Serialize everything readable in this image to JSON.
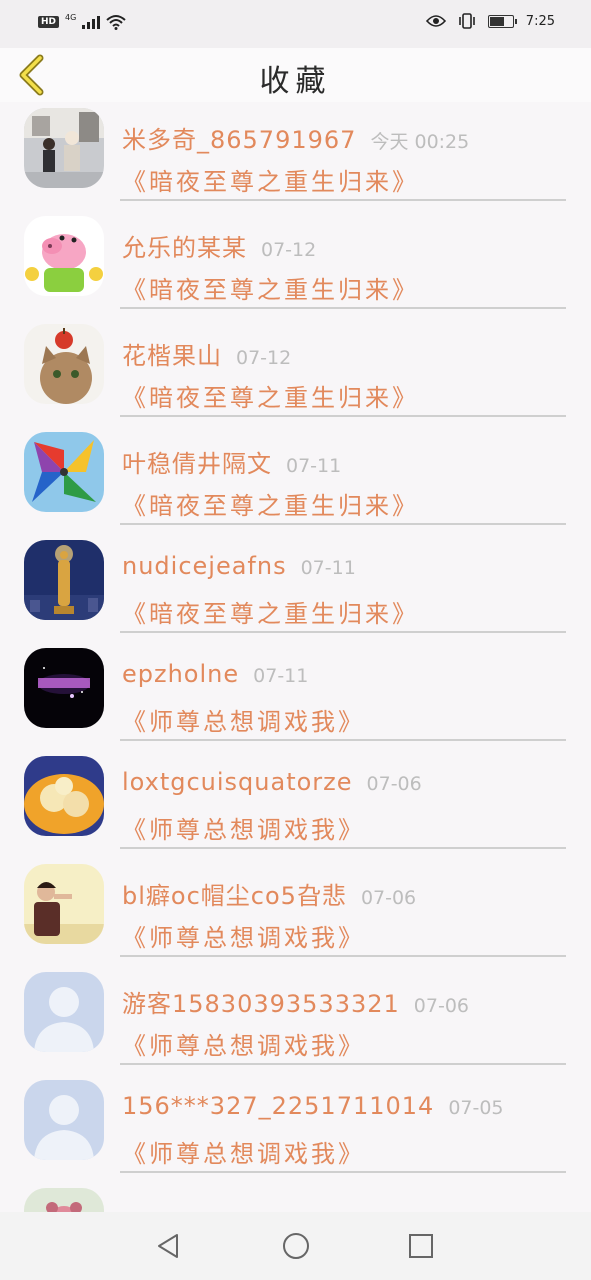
{
  "status_bar": {
    "hd": "HD",
    "network": "4G",
    "time": "7:25",
    "battery_level": 0.6
  },
  "header": {
    "title": "收藏",
    "back_icon": "chevron-left-icon"
  },
  "items": [
    {
      "name": "米多奇_865791967",
      "date": "今天 00:25",
      "book": "《暗夜至尊之重生归来》",
      "avatar": "photo-people"
    },
    {
      "name": "允乐的某某",
      "date": "07-12",
      "book": "《暗夜至尊之重生归来》",
      "avatar": "peppa-pig"
    },
    {
      "name": "花楷果山",
      "date": "07-12",
      "book": "《暗夜至尊之重生归来》",
      "avatar": "cat-with-apple"
    },
    {
      "name": "叶稳倩井隔文",
      "date": "07-11",
      "book": "《暗夜至尊之重生归来》",
      "avatar": "pinwheel"
    },
    {
      "name": "nudicejeafns",
      "date": "07-11",
      "book": "《暗夜至尊之重生归来》",
      "avatar": "buddha-statue"
    },
    {
      "name": "epzholne",
      "date": "07-11",
      "book": "《师尊总想调戏我》",
      "avatar": "constellation-dark"
    },
    {
      "name": "loxtgcuisquatorze",
      "date": "07-06",
      "book": "《师尊总想调戏我》",
      "avatar": "food-bowl"
    },
    {
      "name": "bl癖oc帽尘co5旮悲",
      "date": "07-06",
      "book": "《师尊总想调戏我》",
      "avatar": "photo-person"
    },
    {
      "name": "游客15830393533321",
      "date": "07-06",
      "book": "《师尊总想调戏我》",
      "avatar": "default-user"
    },
    {
      "name": "156***327_2251711014",
      "date": "07-05",
      "book": "《师尊总想调戏我》",
      "avatar": "default-user"
    }
  ],
  "nav": {
    "back": "triangle-back-icon",
    "home": "circle-home-icon",
    "recent": "square-recent-icon"
  }
}
